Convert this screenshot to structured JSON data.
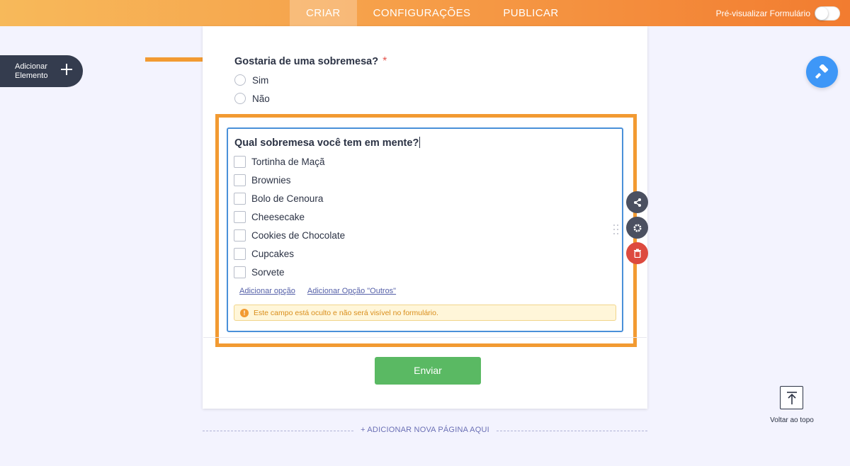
{
  "topbar": {
    "tabs": [
      {
        "label": "CRIAR",
        "active": true
      },
      {
        "label": "CONFIGURAÇÕES",
        "active": false
      },
      {
        "label": "PUBLICAR",
        "active": false
      }
    ],
    "preview_label": "Pré-visualizar Formulário",
    "preview_on": false
  },
  "add_element": {
    "line1": "Adicionar",
    "line2": "Elemento"
  },
  "question1": {
    "title": "Gostaria de uma sobremesa?",
    "required_mark": "*",
    "options": [
      "Sim",
      "Não"
    ]
  },
  "question2": {
    "title": "Qual sobremesa você tem em mente?",
    "options": [
      "Tortinha de Maçã",
      "Brownies",
      "Bolo de Cenoura",
      "Cheesecake",
      "Cookies de Chocolate",
      "Cupcakes",
      "Sorvete"
    ],
    "add_option": "Adicionar opção",
    "add_other": "Adicionar Opção \"Outros\"",
    "warning": "Este campo está oculto e não será visível no formulário.",
    "warning_icon": "!"
  },
  "submit_label": "Enviar",
  "add_page_label": "+ ADICIONAR NOVA PÁGINA AQUI",
  "back_to_top": "Voltar ao topo",
  "colors": {
    "accent_orange": "#f29a32",
    "submit_green": "#5ab963",
    "selection_blue": "#4a90d9",
    "delete_red": "#dd4a3f",
    "designer_blue": "#3e97f7"
  },
  "icons": {
    "add": "plus-icon",
    "designer": "paint-roller-icon",
    "share": "share-icon",
    "settings": "gear-icon",
    "delete": "trash-icon",
    "drag": "drag-handle-icon",
    "back_to_top": "arrow-up-to-line-icon",
    "warning": "warning-icon"
  }
}
